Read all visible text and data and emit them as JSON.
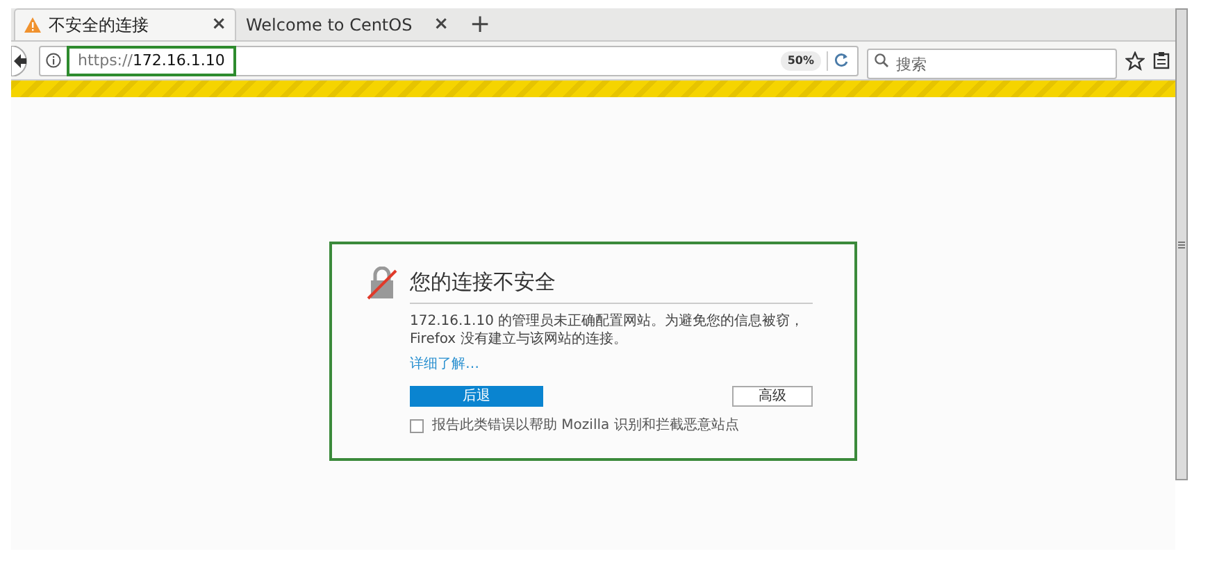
{
  "tabs": [
    {
      "label": "不安全的连接",
      "close": "×",
      "warning": true,
      "selected": true
    },
    {
      "label": "Welcome to CentOS",
      "close": "×",
      "warning": false,
      "selected": false
    }
  ],
  "new_tab": "+",
  "address_bar": {
    "scheme": "https://",
    "host": "172.16.1.10",
    "zoom": "50%"
  },
  "search": {
    "placeholder": "搜索"
  },
  "error": {
    "title": "您的连接不安全",
    "message": "172.16.1.10 的管理员未正确配置网站。为避免您的信息被窃，Firefox 没有建立与该网站的连接。",
    "learn_more": "详细了解…",
    "back_button": "后退",
    "advanced_button": "高级",
    "report": {
      "label": "报告此类错误以帮助 Mozilla 识别和拦截恶意站点",
      "checked": false
    }
  }
}
